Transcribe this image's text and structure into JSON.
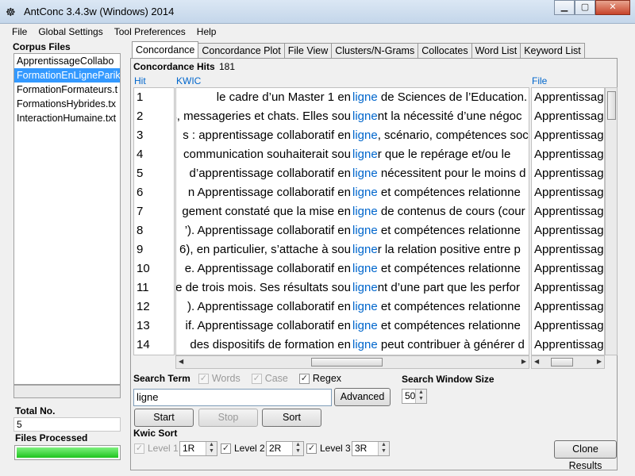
{
  "window": {
    "title": "AntConc 3.4.3w (Windows) 2014"
  },
  "menu": [
    "File",
    "Global Settings",
    "Tool Preferences",
    "Help"
  ],
  "corpus": {
    "label": "Corpus Files",
    "files": [
      "ApprentissageCollabo",
      "FormationEnLigneParik",
      "FormationFormateurs.t",
      "FormationsHybrides.tx",
      "InteractionHumaine.txt"
    ],
    "selected_index": 1
  },
  "totals": {
    "total_label": "Total No.",
    "total_value": "5",
    "processed_label": "Files Processed",
    "processed_fraction": 1.0
  },
  "tabs": [
    "Concordance",
    "Concordance Plot",
    "File View",
    "Clusters/N-Grams",
    "Collocates",
    "Word List",
    "Keyword List"
  ],
  "concordance": {
    "hits_label": "Concordance Hits",
    "hits_value": "181",
    "headers": {
      "hit": "Hit",
      "kwic": "KWIC",
      "file": "File"
    },
    "rows": [
      {
        "hit": "1",
        "left": "le cadre d’un Master 1 en",
        "kw": "ligne",
        "rest": " de Sciences de l’Education.",
        "file": "Apprentissag"
      },
      {
        "hit": "2",
        "left": "s, messageries et chats. Elles sou",
        "kw": "ligne",
        "rest": "nt la nécessité d’une négoc",
        "file": "Apprentissag"
      },
      {
        "hit": "3",
        "left": "s : apprentissage collaboratif en",
        "kw": "ligne",
        "rest": ", scénario, compétences soc",
        "file": "Apprentissag"
      },
      {
        "hit": "4",
        "left": "communication souhaiterait sou",
        "kw": "ligne",
        "rest": "r que le repérage et/ou le",
        "file": "Apprentissag"
      },
      {
        "hit": "5",
        "left": "d’apprentissage collaboratif en",
        "kw": "ligne",
        "rest": " nécessitent pour le moins d",
        "file": "Apprentissag"
      },
      {
        "hit": "6",
        "left": "n Apprentissage collaboratif en",
        "kw": "ligne",
        "rest": " et compétences relationne",
        "file": "Apprentissag"
      },
      {
        "hit": "7",
        "left": "gement constaté que la mise en",
        "kw": "ligne",
        "rest": " de contenus de cours (cour",
        "file": "Apprentissag"
      },
      {
        "hit": "8",
        "left": "’). Apprentissage collaboratif en",
        "kw": "ligne",
        "rest": " et compétences relationne",
        "file": "Apprentissag"
      },
      {
        "hit": "9",
        "left": "6), en particulier, s’attache à sou",
        "kw": "ligne",
        "rest": "r la relation positive entre p",
        "file": "Apprentissag"
      },
      {
        "hit": "10",
        "left": "e. Apprentissage collaboratif en",
        "kw": "ligne",
        "rest": " et compétences relationne",
        "file": "Apprentissag"
      },
      {
        "hit": "11",
        "left": "e de trois mois. Ses résultats sou",
        "kw": "ligne",
        "rest": "nt d’une part que les perfor",
        "file": "Apprentissag"
      },
      {
        "hit": "12",
        "left": "). Apprentissage collaboratif en",
        "kw": "ligne",
        "rest": " et compétences relationne",
        "file": "Apprentissag"
      },
      {
        "hit": "13",
        "left": "if. Apprentissage collaboratif en",
        "kw": "ligne",
        "rest": " et compétences relationne",
        "file": "Apprentissag"
      },
      {
        "hit": "14",
        "left": "des dispositifs de formation en",
        "kw": "ligne",
        "rest": " peut contribuer à générer d",
        "file": "Apprentissag"
      }
    ]
  },
  "search": {
    "term_label": "Search Term",
    "words_label": "Words",
    "words_checked": true,
    "case_label": "Case",
    "case_checked": true,
    "regex_label": "Regex",
    "regex_checked": true,
    "value": "ligne",
    "advanced_label": "Advanced",
    "window_label": "Search Window Size",
    "window_value": "50",
    "start_label": "Start",
    "stop_label": "Stop",
    "sort_label": "Sort"
  },
  "kwic_sort": {
    "label": "Kwic Sort",
    "level1_label": "Level 1",
    "level1_value": "1R",
    "level2_label": "Level 2",
    "level2_value": "2R",
    "level3_label": "Level 3",
    "level3_value": "3R",
    "clone_label": "Clone Results"
  }
}
